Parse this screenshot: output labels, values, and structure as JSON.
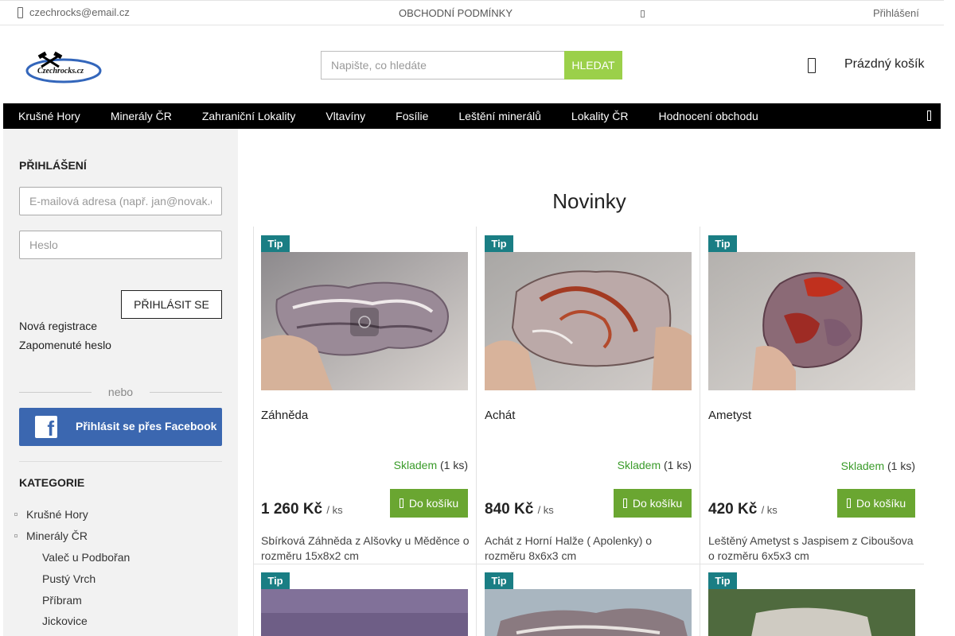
{
  "topbar": {
    "email": "czechrocks@email.cz",
    "terms": "OBCHODNÍ PODMÍNKY",
    "login": "Přihlášení"
  },
  "header": {
    "logo_text": "Czechrocks.cz",
    "search_placeholder": "Napište, co hledáte",
    "search_button": "HLEDAT",
    "cart_label": "Prázdný košík"
  },
  "nav": {
    "items": [
      "Krušné Hory",
      "Minerály ČR",
      "Zahraniční Lokality",
      "Vltavíny",
      "Fosílie",
      "Leštění minerálů",
      "Lokality ČR",
      "Hodnocení obchodu"
    ]
  },
  "sidebar": {
    "login_title": "PŘIHLÁŠENÍ",
    "email_placeholder": "E-mailová adresa (např. jan@novak.cz)",
    "password_placeholder": "Heslo",
    "login_button": "PŘIHLÁSIT SE",
    "register": "Nová registrace",
    "forgot": "Zapomenuté heslo",
    "or": "nebo",
    "facebook": "Přihlásit se přes Facebook",
    "categories_title": "KATEGORIE",
    "categories": [
      "Krušné Hory",
      "Minerály ČR"
    ],
    "subcategories": [
      "Valeč u Podbořan",
      "Pustý Vrch",
      "Příbram",
      "Jickovice"
    ]
  },
  "main": {
    "title": "Novinky",
    "tip_label": "Tip",
    "products": [
      {
        "name": "Záhněda",
        "stock_status": "Skladem",
        "stock_qty": "(1 ks)",
        "price": "1 260 Kč",
        "unit": "/ ks",
        "add": "Do košíku",
        "desc": "Sbírková Záhněda z Alšovky u Měděnce o rozměru  15x8x2 cm"
      },
      {
        "name": "Achát",
        "stock_status": "Skladem",
        "stock_qty": "(1 ks)",
        "price": "840 Kč",
        "unit": "/ ks",
        "add": "Do košíku",
        "desc": "Achát z Horní Halže ( Apolenky) o rozměru 8x6x3 cm"
      },
      {
        "name": "Ametyst",
        "stock_status": "Skladem",
        "stock_qty": "(1 ks)",
        "price": "420 Kč",
        "unit": "/ ks",
        "add": "Do košíku",
        "desc": "Leštěný Ametyst s Jaspisem z Ciboušova o rozměru 6x5x3 cm"
      }
    ]
  }
}
